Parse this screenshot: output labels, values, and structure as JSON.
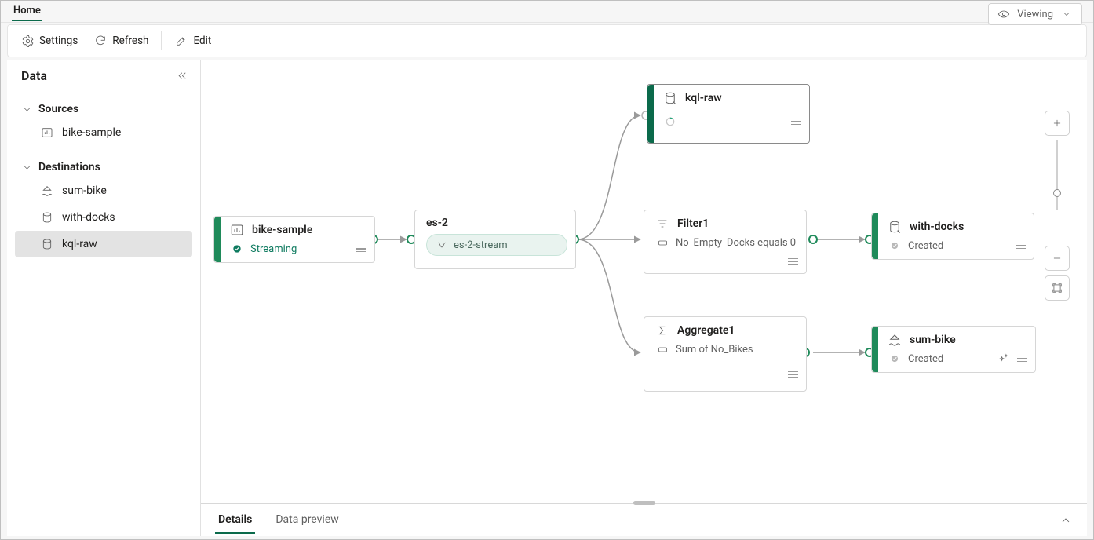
{
  "tab": {
    "home": "Home"
  },
  "view_mode": {
    "label": "Viewing"
  },
  "toolbar": {
    "settings": "Settings",
    "refresh": "Refresh",
    "edit": "Edit"
  },
  "sidebar": {
    "title": "Data",
    "sources_label": "Sources",
    "destinations_label": "Destinations",
    "sources": [
      {
        "label": "bike-sample"
      }
    ],
    "destinations": [
      {
        "label": "sum-bike"
      },
      {
        "label": "with-docks"
      },
      {
        "label": "kql-raw",
        "selected": true
      }
    ]
  },
  "nodes": {
    "bikesample": {
      "title": "bike-sample",
      "status": "Streaming"
    },
    "es2": {
      "title": "es-2",
      "pill": "es-2-stream"
    },
    "kqlraw": {
      "title": "kql-raw"
    },
    "filter1": {
      "title": "Filter1",
      "sub": "No_Empty_Docks equals 0"
    },
    "aggregate1": {
      "title": "Aggregate1",
      "sub": "Sum of No_Bikes"
    },
    "withdocks": {
      "title": "with-docks",
      "status": "Created"
    },
    "sumbike": {
      "title": "sum-bike",
      "status": "Created"
    }
  },
  "bottom": {
    "details": "Details",
    "preview": "Data preview"
  }
}
